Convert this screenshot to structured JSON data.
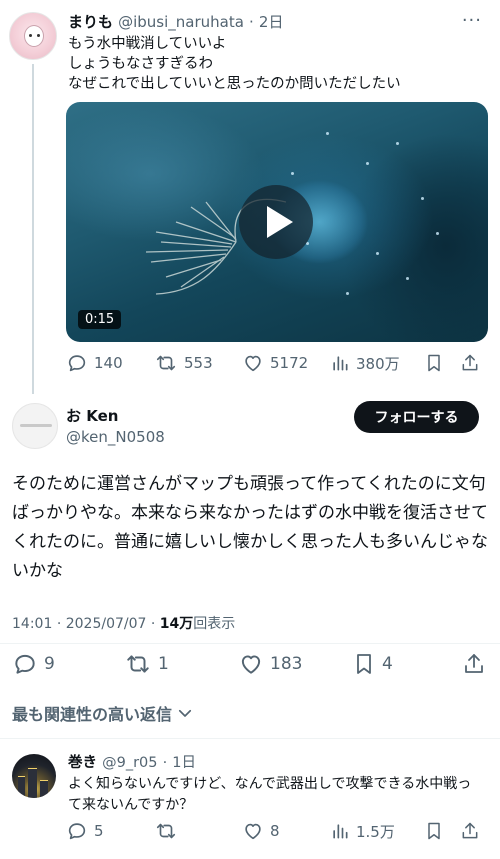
{
  "parent_tweet": {
    "name": "まりも",
    "handle": "@ibusi_naruhata",
    "separator": "·",
    "time": "2日",
    "more_label": "···",
    "text_lines": [
      "もう水中戦消していいよ",
      "しょうもなさすぎるわ",
      "なぜこれで出していいと思ったのか問いただしたい"
    ],
    "video_duration": "0:15",
    "actions": {
      "replies": "140",
      "reposts": "553",
      "likes": "5172",
      "views": "380万"
    }
  },
  "main_tweet": {
    "name": "お Ken",
    "handle": "@ken_N0508",
    "follow_label": "フォローする",
    "text_lines": [
      "そのために運営さんがマップも頑張って作ってくれたのに文句",
      "ばっかりやな。本来なら来なかったはずの水中戦を復活させて",
      "くれたのに。普通に嬉しいし懐かしく思った人も多いんじゃな",
      "いかな"
    ],
    "time": "14:01",
    "date": "2025/07/07",
    "view_count": "14万",
    "view_suffix": "回表示",
    "actions": {
      "replies": "9",
      "reposts": "1",
      "likes": "183",
      "bookmarks": "4"
    }
  },
  "sort": {
    "label": "最も関連性の高い返信"
  },
  "reply": {
    "name": "巻き",
    "handle": "@9_r05",
    "separator": "·",
    "time": "1日",
    "text_lines": [
      "よく知らないんですけど、なんで武器出しで攻撃できる水中戦っ",
      "て来ないんですか？"
    ],
    "actions": {
      "replies": "5",
      "reposts": "",
      "likes": "8",
      "views": "1.5万"
    }
  },
  "colors": {
    "text": "#0f1419",
    "secondary": "#536471",
    "divider": "#eff3f4",
    "thread_line": "#cfd9de"
  }
}
